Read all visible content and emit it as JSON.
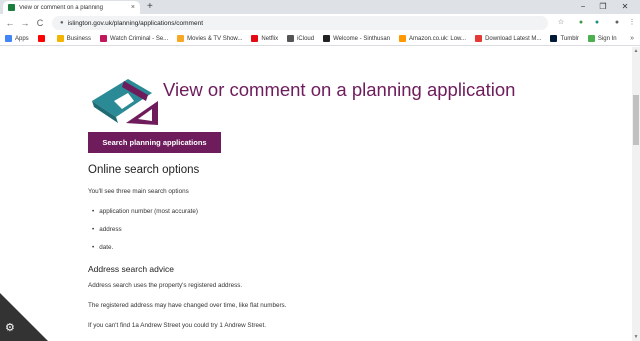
{
  "browser": {
    "tab_title": "View or comment on a planning",
    "tab_close": "×",
    "new_tab": "+",
    "window_controls": [
      "−",
      "❐",
      "✕"
    ],
    "url": "islington.gov.uk/planning/applications/comment",
    "nav": {
      "back": "←",
      "forward": "→",
      "reload": "C"
    },
    "right_icons": [
      "☆",
      "⬤",
      "⬤",
      "⬤",
      "⋮"
    ],
    "bookmarks": [
      {
        "label": "Apps",
        "color": "#4285f4"
      },
      {
        "label": "",
        "color": "#ff0000"
      },
      {
        "label": "Business",
        "color": "#f4b400"
      },
      {
        "label": "Watch Criminal - Se...",
        "color": "#c2185b"
      },
      {
        "label": "Movies & TV Show...",
        "color": "#f9a825"
      },
      {
        "label": "Netflix",
        "color": "#e50914"
      },
      {
        "label": "iCloud",
        "color": "#555555"
      },
      {
        "label": "Welcome - Sinthusan",
        "color": "#222222"
      },
      {
        "label": "Amazon.co.uk: Low...",
        "color": "#ff9900"
      },
      {
        "label": "Download Latest M...",
        "color": "#e53935"
      },
      {
        "label": "Tumblr",
        "color": "#001935"
      },
      {
        "label": "Sign In",
        "color": "#4caf50"
      }
    ],
    "bookmarks_more": "»"
  },
  "page": {
    "heading": "View or comment on a planning application",
    "search_button": "Search planning applications",
    "online_search_title": "Online search options",
    "intro": "You'll see three main search options",
    "options": [
      "application number (most accurate)",
      "address",
      "date."
    ],
    "address_advice_title": "Address search advice",
    "advice": [
      "Address search uses the property's registered address.",
      "The registered address may have changed over time, like flat numbers.",
      "If you can't find 1a Andrew Street you could try 1 Andrew Street."
    ]
  },
  "colors": {
    "brand": "#6e1c5c",
    "teal": "#2a8a95"
  },
  "icons": {
    "settings": "⚙",
    "lock": "🔒"
  }
}
